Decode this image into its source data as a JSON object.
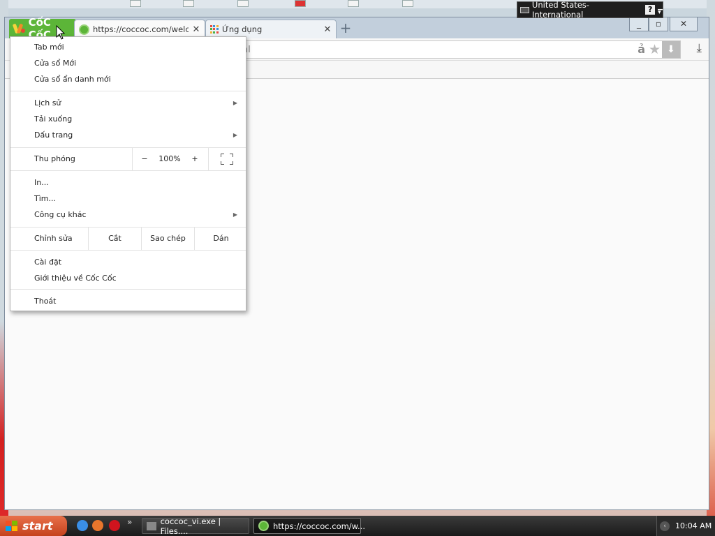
{
  "browser": {
    "logo_text": "CốC CốC",
    "tabs": [
      {
        "title": "https://coccoc.com/welcome",
        "icon": "coccoc-icon"
      },
      {
        "title": "Ứng dụng",
        "icon": "apps-grid-icon"
      }
    ],
    "address": "ml",
    "translate_label": "ả"
  },
  "menu": {
    "new_tab": "Tab mới",
    "new_window": "Cửa sổ Mới",
    "incognito": "Cửa sổ ẩn danh mới",
    "history": "Lịch sử",
    "downloads": "Tải xuống",
    "bookmarks": "Dấu trang",
    "zoom_label": "Thu phóng",
    "zoom_minus": "−",
    "zoom_value": "100%",
    "zoom_plus": "+",
    "print": "In...",
    "find": "Tìm...",
    "more_tools": "Công cụ khác",
    "edit_label": "Chỉnh sửa",
    "cut": "Cắt",
    "copy": "Sao chép",
    "paste": "Dán",
    "settings": "Cài đặt",
    "about": "Giới thiệu về Cốc Cốc",
    "exit": "Thoát"
  },
  "langbar": {
    "label": "United States-International",
    "help": "?"
  },
  "taskbar": {
    "start": "start",
    "tasks": [
      {
        "label": "coccoc_vi.exe | Files...."
      },
      {
        "label": "https://coccoc.com/w..."
      }
    ],
    "clock": "10:04 AM",
    "more": "»"
  }
}
